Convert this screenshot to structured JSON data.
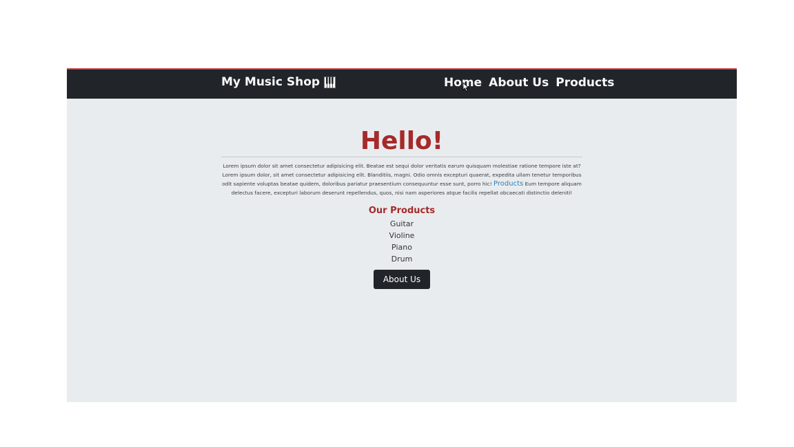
{
  "navbar": {
    "brand": "My Music Shop",
    "brand_icon": "piano-icon",
    "links": [
      "Home",
      "About Us",
      "Products"
    ]
  },
  "main": {
    "heading": "Hello!",
    "paragraph_before_link": "Lorem ipsum dolor sit amet consectetur adipisicing elit. Beatae est sequi dolor veritatis earum quisquam molestiae ratione tempore iste at? Lorem ipsum dolor, sit amet consectetur adipisicing elit. Blanditiis, magni. Odio omnis excepturi quaerat, expedita ullam tenetur temporibus odit sapiente voluptas beatae quidem, doloribus pariatur praesentium consequuntur esse sunt, porro hic!",
    "paragraph_link": "Products",
    "paragraph_after_link": "Eum tempore aliquam delectus facere, excepturi laborum deserunt repellendus, quos, nisi nam asperiores atque facilis repellat obcaecati distinctio deleniti!",
    "products_heading": "Our Products",
    "products": [
      "Guitar",
      "Violine",
      "Piano",
      "Drum"
    ],
    "button_label": "About Us"
  },
  "colors": {
    "navbar_bg": "#212529",
    "accent": "#a52a2a",
    "page_bg": "#e9ecef",
    "link": "#2d7fb8"
  }
}
